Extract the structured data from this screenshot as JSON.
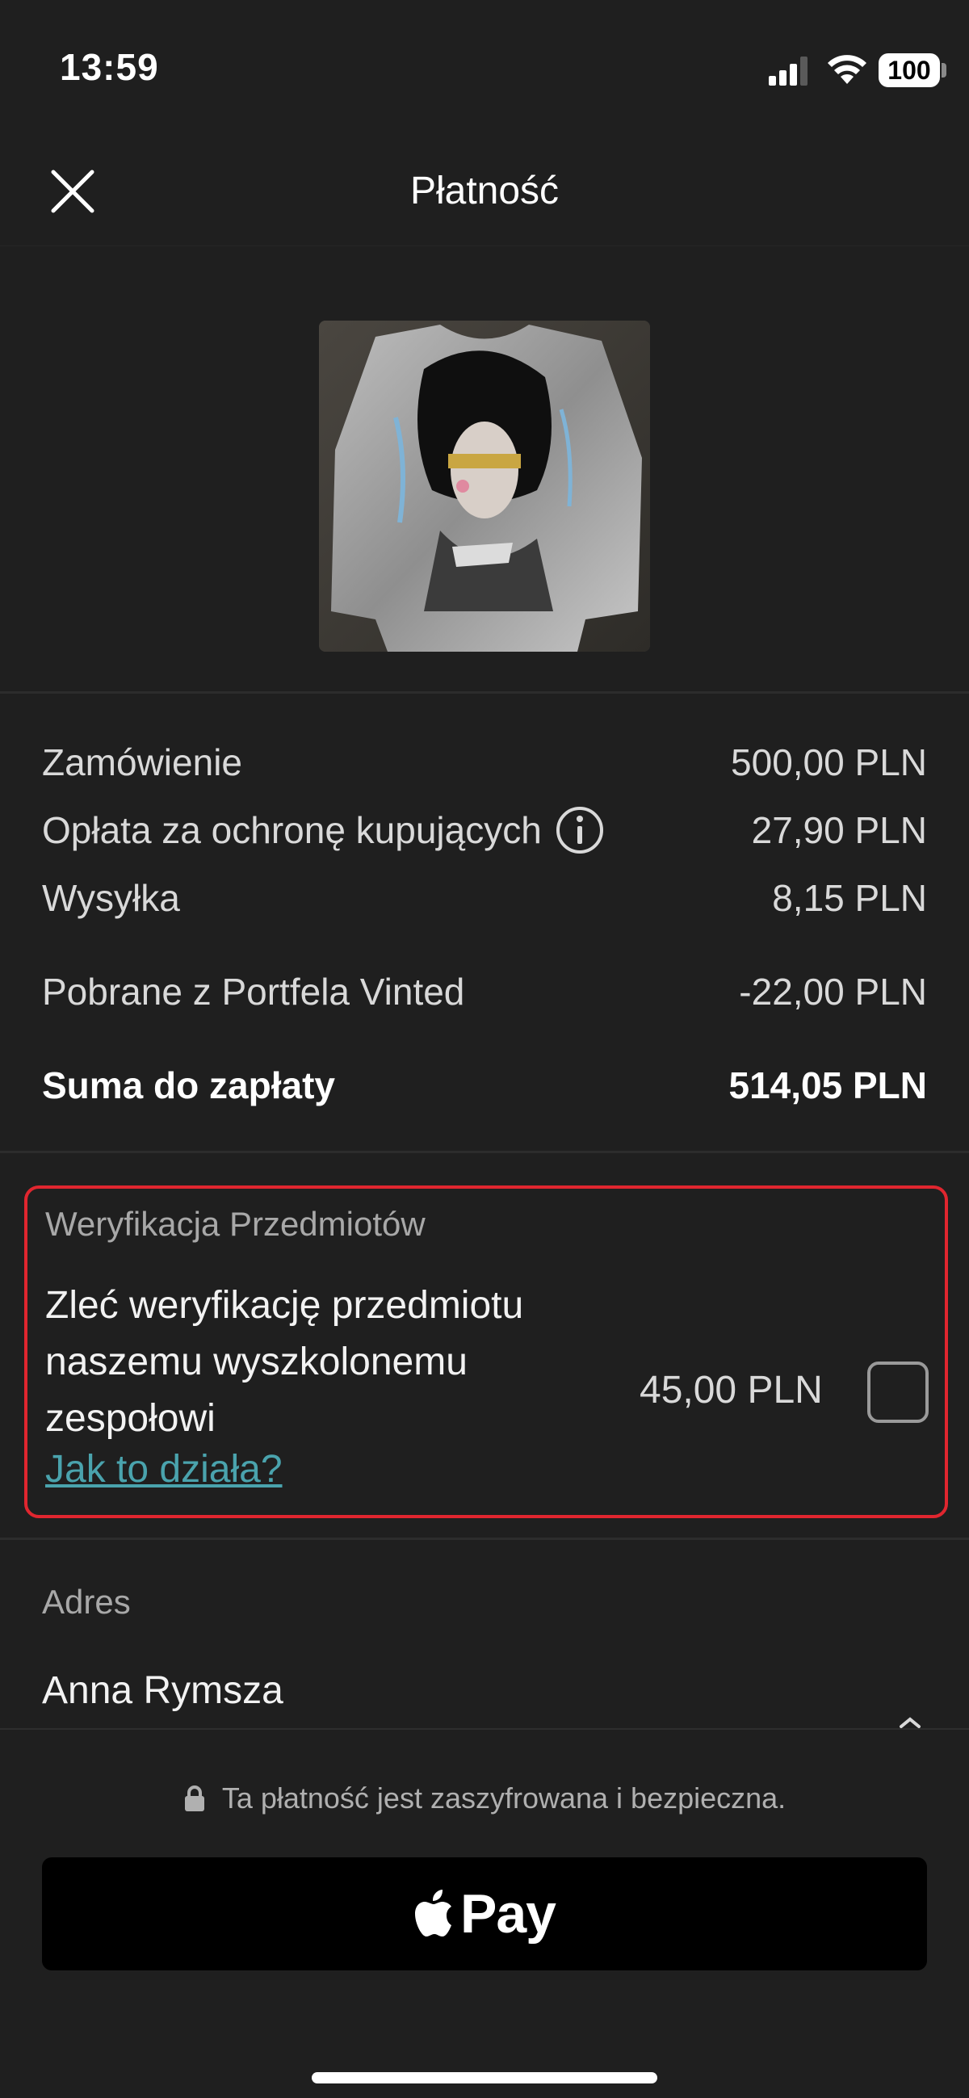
{
  "status_bar": {
    "time": "13:59",
    "battery": "100"
  },
  "header": {
    "title": "Płatność",
    "close_icon": "close-icon"
  },
  "product": {
    "image_alt": "sweatshirt-photo"
  },
  "summary": {
    "rows": [
      {
        "label": "Zamówienie",
        "value": "500,00 PLN"
      },
      {
        "label": "Opłata za ochronę kupujących",
        "value": "27,90 PLN"
      },
      {
        "label": "Wysyłka",
        "value": "8,15 PLN"
      },
      {
        "label": "Pobrane z Portfela Vinted",
        "value": "-22,00 PLN"
      }
    ],
    "total": {
      "label": "Suma do zapłaty",
      "value": "514,05 PLN"
    }
  },
  "verification": {
    "heading": "Weryfikacja Przedmiotów",
    "description": "Zleć weryfikację przedmiotu naszemu wyszkolonemu zespołowi",
    "link": "Jak to działa?",
    "price": "45,00 PLN",
    "checked": false,
    "highlight_color": "#e0262f"
  },
  "address": {
    "heading": "Adres",
    "name": "Anna Rymsza"
  },
  "payment": {
    "secure_text": "Ta płatność jest zaszyfrowana i bezpieczna.",
    "button_label": "Pay",
    "button_icon": "apple-logo-icon"
  },
  "colors": {
    "background": "#1f1f1f",
    "link": "#4aa3ad",
    "button": "#000000"
  }
}
